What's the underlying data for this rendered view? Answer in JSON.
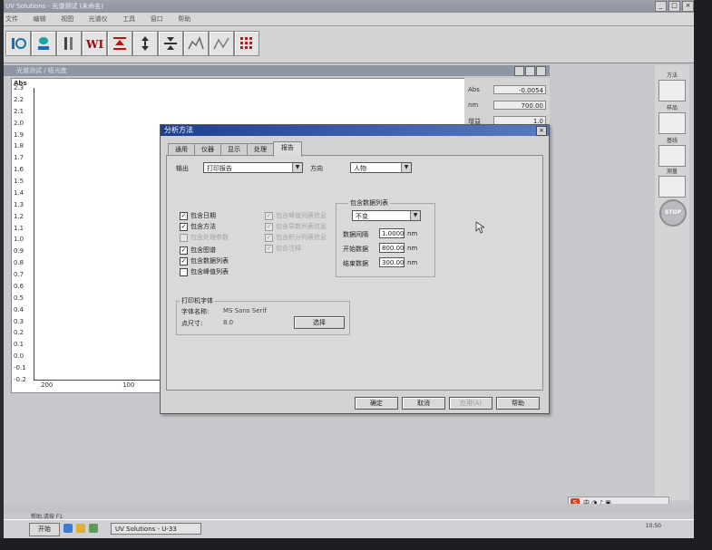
{
  "app": {
    "title": "UV Solutions - 光谱测试 (未命名)",
    "menu": [
      "文件",
      "编辑",
      "视图",
      "光谱仪",
      "工具",
      "窗口",
      "帮助"
    ]
  },
  "toolbar": {
    "buttons": [
      "info-icon",
      "cuvette-icon",
      "sample-icon",
      "wl-icon",
      "red-arrow-icon",
      "expand-icon",
      "compress-icon",
      "baseline-icon",
      "scan-icon",
      "grid-icon"
    ],
    "wl_text": "WL"
  },
  "inner_window": {
    "title": "光谱测试 / 吸光度",
    "y_label": "Abs",
    "y_ticks": [
      "2.3",
      "2.2",
      "2.1",
      "2.0",
      "1.9",
      "1.8",
      "1.7",
      "1.6",
      "1.5",
      "1.4",
      "1.3",
      "1.2",
      "1.1",
      "1.0",
      "0.9",
      "0.8",
      "0.7",
      "0.6",
      "0.5",
      "0.4",
      "0.3",
      "0.2",
      "0.1",
      "0.0",
      "-0.1",
      "-0.2"
    ],
    "x_ticks": [
      "200",
      "100"
    ],
    "readouts": [
      {
        "label": "Abs",
        "value": "-0.0054"
      },
      {
        "label": "nm",
        "value": "700.00"
      },
      {
        "label": "增益",
        "value": "1.0"
      }
    ]
  },
  "right_column": {
    "items": [
      "方法",
      "样品",
      "基线",
      "测量"
    ],
    "stop_label": "STOP"
  },
  "dialog": {
    "title": "分析方法",
    "close_label": "×",
    "tabs": [
      "通用",
      "仪器",
      "显示",
      "处理",
      "报告"
    ],
    "active_tab": "报告",
    "output_label": "输出",
    "output_value": "打印报告",
    "direction_label": "方向",
    "direction_value": "人物",
    "checkboxes_left": [
      {
        "label": "包含日期",
        "checked": true,
        "enabled": true
      },
      {
        "label": "包含方法",
        "checked": true,
        "enabled": true
      },
      {
        "label": "包含处理参数",
        "checked": false,
        "enabled": false
      },
      {
        "label": "包含图谱",
        "checked": true,
        "enabled": true
      },
      {
        "label": "包含数据列表",
        "checked": true,
        "enabled": true
      },
      {
        "label": "包含峰值列表",
        "checked": false,
        "enabled": true
      }
    ],
    "checkboxes_mid": [
      {
        "label": "包含峰值列表信息",
        "checked": true
      },
      {
        "label": "包含导数列表信息",
        "checked": true
      },
      {
        "label": "包含积分列表信息",
        "checked": true
      },
      {
        "label": "包含注释",
        "checked": true
      }
    ],
    "data_list_group": {
      "title": "包含数据列表",
      "select_value": "不变",
      "fields": [
        {
          "label": "数据间隔",
          "value": "1.0000",
          "unit": "nm"
        },
        {
          "label": "开始数据",
          "value": "800.00",
          "unit": "nm"
        },
        {
          "label": "结束数据",
          "value": "300.00",
          "unit": "nm"
        }
      ]
    },
    "printer_font": {
      "title": "打印机字体",
      "name_label": "字体名称:",
      "name_value": "MS Sans Serif",
      "size_label": "点尺寸:",
      "size_value": "8.0",
      "select_button": "选择"
    },
    "buttons": {
      "ok": "确定",
      "cancel": "取消",
      "apply": "应用(A)",
      "help": "帮助"
    }
  },
  "statusbar": {
    "text": "帮助,请按 F1"
  },
  "taskbar": {
    "start": "开始",
    "task_label": "UV Solutions - U-33",
    "clock": "10:50",
    "tray": "中 ◑ ♪ ▣"
  }
}
